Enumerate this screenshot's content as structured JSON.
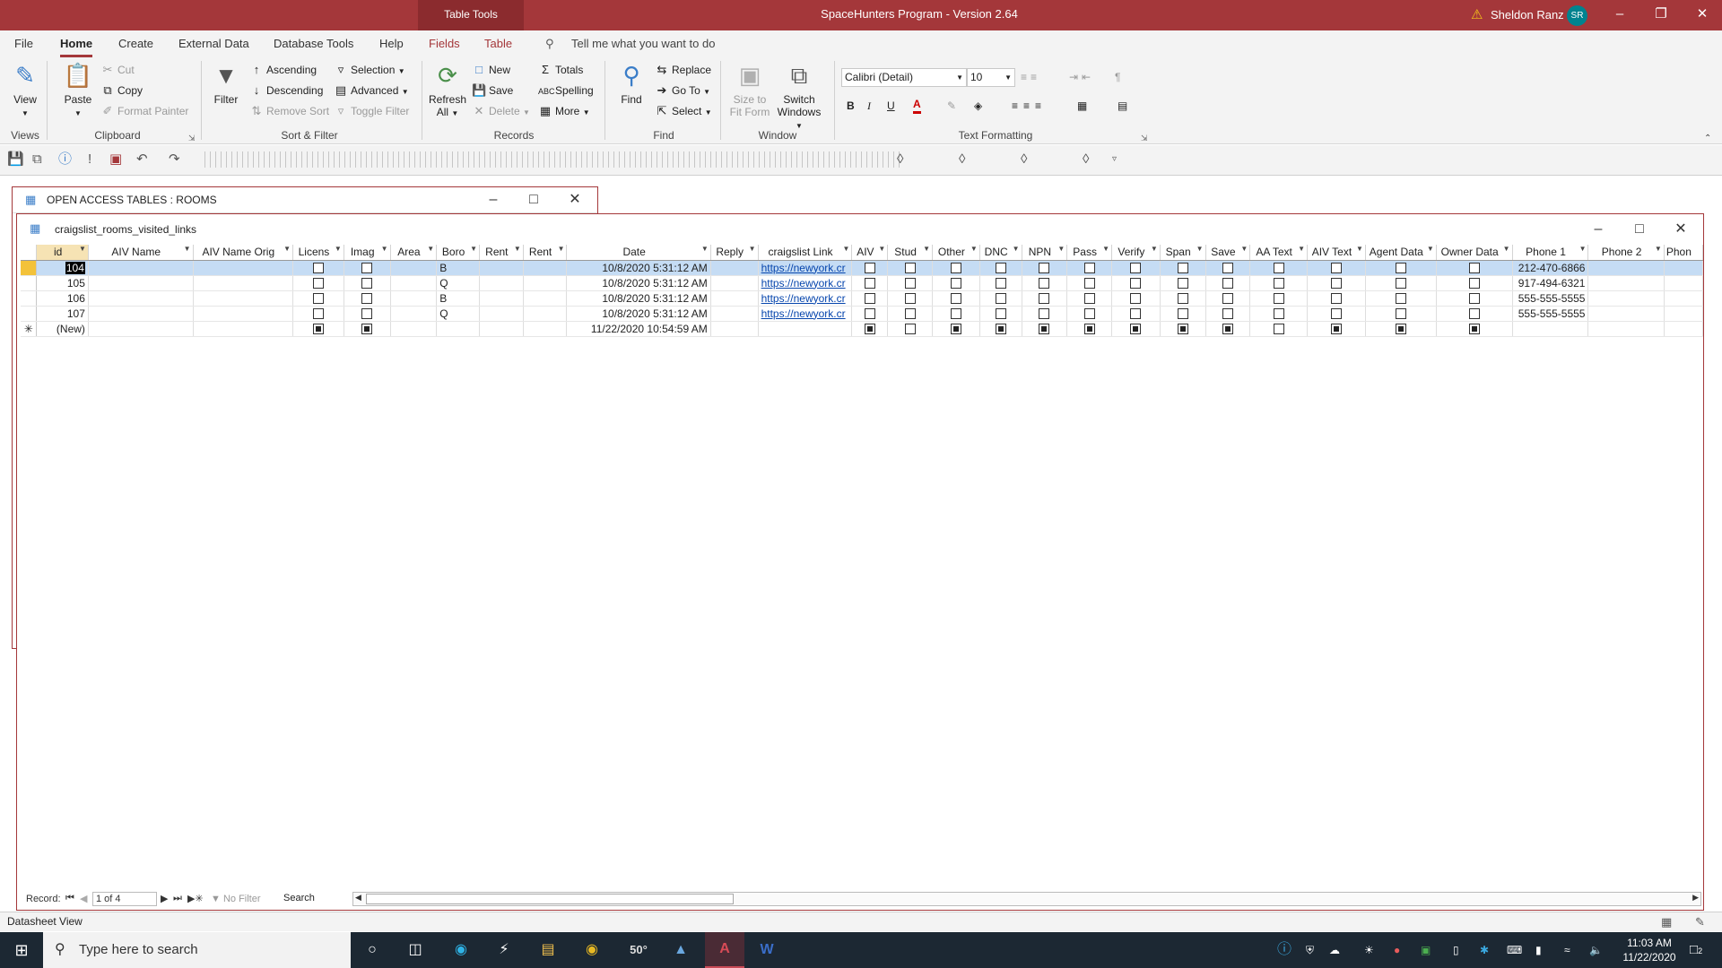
{
  "titlebar": {
    "tool_tab": "Table Tools",
    "app_title": "SpaceHunters Program - Version 2.64",
    "user_name": "Sheldon Ranz",
    "user_initials": "SR",
    "accent": "#a4373a"
  },
  "menu": {
    "tabs": [
      "File",
      "Home",
      "Create",
      "External Data",
      "Database Tools",
      "Help",
      "Fields",
      "Table"
    ],
    "active": "Home",
    "tell_me": "Tell me what you want to do"
  },
  "ribbon": {
    "views": {
      "view": "View",
      "group": "Views"
    },
    "clipboard": {
      "paste": "Paste",
      "cut": "Cut",
      "copy": "Copy",
      "format_painter": "Format Painter",
      "group": "Clipboard"
    },
    "sort_filter": {
      "filter": "Filter",
      "ascending": "Ascending",
      "descending": "Descending",
      "remove_sort": "Remove Sort",
      "selection": "Selection",
      "advanced": "Advanced",
      "toggle_filter": "Toggle Filter",
      "group": "Sort & Filter"
    },
    "records": {
      "refresh": "Refresh",
      "refresh2": "All",
      "new": "New",
      "save": "Save",
      "delete": "Delete",
      "totals": "Totals",
      "spelling": "Spelling",
      "more": "More",
      "group": "Records"
    },
    "find": {
      "find": "Find",
      "replace": "Replace",
      "goto": "Go To",
      "select": "Select",
      "group": "Find"
    },
    "window": {
      "size_to": "Size to",
      "fit_form": "Fit Form",
      "switch": "Switch",
      "windows": "Windows",
      "group": "Window"
    },
    "text_formatting": {
      "font": "Calibri (Detail)",
      "size": "10",
      "bold": "B",
      "italic": "I",
      "underline": "U",
      "group": "Text Formatting"
    }
  },
  "windows": {
    "back_title": "OPEN ACCESS TABLES : ROOMS",
    "front_title": "craigslist_rooms_visited_links"
  },
  "table": {
    "columns": [
      "id",
      "AIV Name",
      "AIV Name Orig",
      "Licens",
      "Imag",
      "Area",
      "Boro",
      "Rent",
      "Rent",
      "Date",
      "Reply",
      "craigslist Link",
      "AIV",
      "Stud",
      "Other",
      "DNC",
      "NPN",
      "Pass",
      "Verify",
      "Span",
      "Save",
      "AA Text",
      "AIV Text",
      "Agent Data",
      "Owner Data",
      "Phone 1",
      "Phone 2",
      "Phon"
    ],
    "rows": [
      {
        "id": "104",
        "boro": "B",
        "date": "10/8/2020 5:31:12 AM",
        "link": "https://newyork.cr",
        "phone1": "212-470-6866"
      },
      {
        "id": "105",
        "boro": "Q",
        "date": "10/8/2020 5:31:12 AM",
        "link": "https://newyork.cr",
        "phone1": "917-494-6321"
      },
      {
        "id": "106",
        "boro": "B",
        "date": "10/8/2020 5:31:12 AM",
        "link": "https://newyork.cr",
        "phone1": "555-555-5555"
      },
      {
        "id": "107",
        "boro": "Q",
        "date": "10/8/2020 5:31:12 AM",
        "link": "https://newyork.cr",
        "phone1": "555-555-5555"
      }
    ],
    "new_row": {
      "id": "(New)",
      "date": "11/22/2020 10:54:59 AM"
    }
  },
  "navigation": {
    "record_label": "Record:",
    "position": "1 of 4",
    "filter": "No Filter",
    "search": "Search"
  },
  "status": {
    "view": "Datasheet View"
  },
  "taskbar": {
    "search_placeholder": "Type here to search",
    "weather": "50°",
    "time": "11:03 AM",
    "date": "11/22/2020",
    "notifications": "2"
  }
}
